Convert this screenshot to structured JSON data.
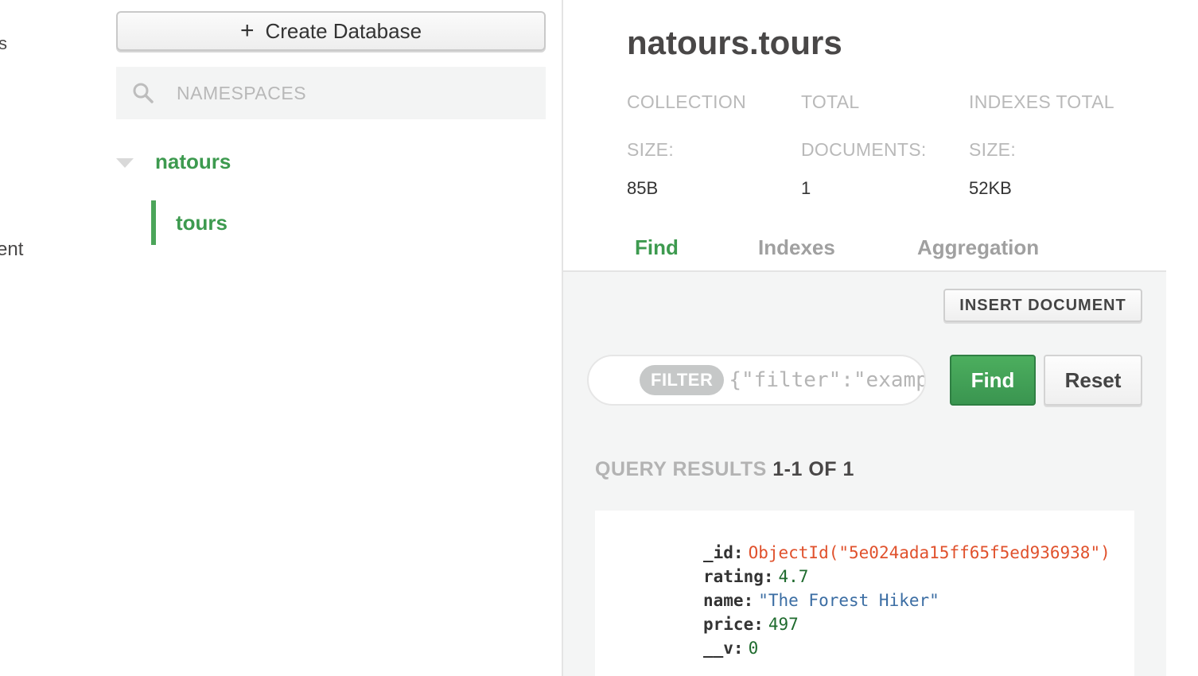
{
  "left_edge": {
    "fragment_1": "s",
    "fragment_2": "ent"
  },
  "sidebar": {
    "create_database_label": "Create Database",
    "namespace_search_placeholder": "NAMESPACES",
    "database": "natours",
    "collection": "tours"
  },
  "header": {
    "namespace": "natours.tours",
    "stats": [
      {
        "label_line1": "COLLECTION",
        "label_line2": "SIZE:",
        "value": "85B"
      },
      {
        "label_line1": "TOTAL",
        "label_line2": "DOCUMENTS:",
        "value": "1"
      },
      {
        "label_line1": "INDEXES TOTAL",
        "label_line2": "SIZE:",
        "value": "52KB"
      }
    ]
  },
  "tabs": [
    {
      "label": "Find",
      "active": true
    },
    {
      "label": "Indexes",
      "active": false
    },
    {
      "label": "Aggregation",
      "active": false
    }
  ],
  "toolbar": {
    "insert_document_label": "INSERT DOCUMENT",
    "filter_pill": "FILTER",
    "filter_placeholder": "{\"filter\":\"example\"}",
    "find_label": "Find",
    "reset_label": "Reset"
  },
  "results": {
    "label": "QUERY RESULTS",
    "count": "1-1 OF 1"
  },
  "document": {
    "fields": [
      {
        "key": "_id:",
        "value": "ObjectId(\"5e024ada15ff65f5ed936938\")",
        "kind": "oid"
      },
      {
        "key": "rating:",
        "value": "4.7",
        "kind": "num"
      },
      {
        "key": "name:",
        "value": "\"The Forest Hiker\"",
        "kind": "str"
      },
      {
        "key": "price:",
        "value": "497",
        "kind": "num"
      },
      {
        "key": "__v:",
        "value": "0",
        "kind": "num"
      }
    ]
  },
  "colors": {
    "accent_green": "#3d9a4f",
    "objectid_orange": "#e0512c",
    "string_blue": "#3b6da3",
    "number_green": "#1f6b2e"
  }
}
